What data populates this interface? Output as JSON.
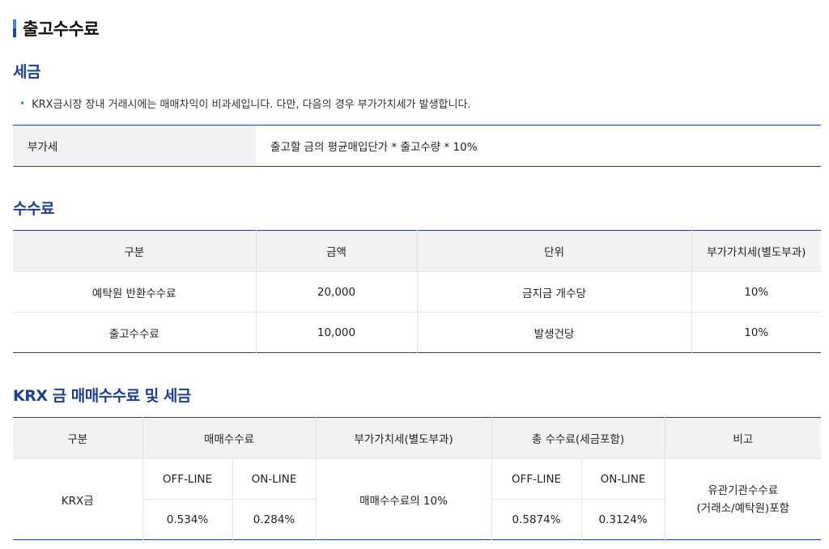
{
  "page": {
    "title": "출고수수료"
  },
  "tax_section": {
    "heading": "세금",
    "note": "KRX금시장 장내 거래시에는 매매차익이 비과세입니다. 다만, 다음의 경우 부가가치세가 발생합니다.",
    "row": {
      "label": "부가세",
      "value": "출고할 금의 평균매입단가 * 출고수량 * 10%"
    }
  },
  "fee_section": {
    "heading": "수수료",
    "headers": [
      "구분",
      "금액",
      "단위",
      "부가가치세(별도부과)"
    ],
    "rows": [
      [
        "예탁원 반환수수료",
        "20,000",
        "금지금 개수당",
        "10%"
      ],
      [
        "출고수수료",
        "10,000",
        "발생건당",
        "10%"
      ]
    ]
  },
  "krx_section": {
    "heading": "KRX 금 매매수수료 및 세금",
    "headers": {
      "category": "구분",
      "trading_fee": "매매수수료",
      "vat": "부가가치세(별도부과)",
      "total_fee": "총 수수료(세금포함)",
      "remarks": "비고"
    },
    "row": {
      "category": "KRX금",
      "offline_label": "OFF-LINE",
      "online_label": "ON-LINE",
      "trading_offline": "0.534%",
      "trading_online": "0.284%",
      "vat": "매매수수료의 10%",
      "total_offline": "0.5874%",
      "total_online": "0.3124%",
      "remarks_line1": "유관기관수수료",
      "remarks_line2": "(거래소/예탁원)포함"
    }
  },
  "colors": {
    "accent": "#1f3f8f",
    "bullet": "#3b8de0",
    "header_bg": "#f2f2f2"
  }
}
